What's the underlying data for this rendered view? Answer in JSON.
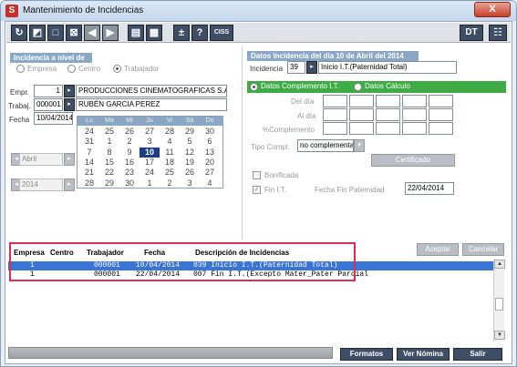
{
  "window": {
    "title": "Mantenimiento de Incidencias",
    "app_icon": "S",
    "close_glyph": "X"
  },
  "toolbar": {
    "buttons": [
      "↻",
      "◩",
      "□",
      "⊠",
      "◀",
      "▶",
      "▤",
      "▦",
      "±",
      "?",
      "CISS"
    ],
    "dt_label": "DT",
    "settings_glyph": "☷"
  },
  "left": {
    "section_title": "Incidencia a nivel de",
    "radio_empresa": "Empresa",
    "radio_centro": "Centro",
    "radio_trabajador": "Trabajador",
    "empr_label": "Empr.",
    "empr_value": "1",
    "empr_name": "PRODUCCIONES CINEMATOGRAFICAS S.A.",
    "trabaj_label": "Trabaj.",
    "trabaj_value": "000001",
    "trabaj_name": "RUBÉN GARCIA PEREZ",
    "fecha_label": "Fecha",
    "fecha_value": "10/04/2014",
    "month_value": "Abril",
    "year_value": "2014"
  },
  "calendar": {
    "days": [
      "Lu",
      "Ma",
      "Mi",
      "Ju",
      "Vi",
      "Sá",
      "Do"
    ],
    "weeks": [
      [
        "24",
        "25",
        "26",
        "27",
        "28",
        "29",
        "30"
      ],
      [
        "31",
        "1",
        "2",
        "3",
        "4",
        "5",
        "6"
      ],
      [
        "7",
        "8",
        "9",
        "10",
        "11",
        "12",
        "13"
      ],
      [
        "14",
        "15",
        "16",
        "17",
        "18",
        "19",
        "20"
      ],
      [
        "21",
        "22",
        "23",
        "24",
        "25",
        "26",
        "27"
      ],
      [
        "28",
        "29",
        "30",
        "1",
        "2",
        "3",
        "4"
      ]
    ],
    "selected_day": "10"
  },
  "right": {
    "section_title": "Datos Incidencia del día 10 de Abril del 2014",
    "incidencia_label": "Incidencia",
    "incidencia_code": "39",
    "incidencia_text": "Inicio I.T.(Paternidad Total)",
    "radio_complemento": "Datos Complemento I.T.",
    "radio_calculo": "Datos Cálculo",
    "del_dia_label": "Del día",
    "al_dia_label": "Al día",
    "complemento_label": "%Complemento",
    "tipo_compl_label": "Tipo Compl.",
    "tipo_compl_value": "no complementa",
    "certificado_btn": "Certificado",
    "bonificada_label": "Bonificada",
    "fin_it_label": "Fin I.T.",
    "fecha_fin_label": "Fecha Fin Paternidad",
    "fecha_fin_value": "22/04/2014",
    "aceptar_btn": "Aceptar",
    "cancelar_btn": "Cancelar"
  },
  "table": {
    "headers": [
      "Empresa",
      "Centro",
      "Trabajador",
      "Fecha",
      "Descripción de Incidencias"
    ],
    "rows": [
      {
        "empresa": "1",
        "centro": "",
        "trabajador": "000001",
        "fecha": "10/04/2014",
        "descripcion": "039 Inicio I.T.(Paternidad Total)"
      },
      {
        "empresa": "1",
        "centro": "",
        "trabajador": "000001",
        "fecha": "22/04/2014",
        "descripcion": "007 Fin I.T.(Excepto Mater_Pater Parcial"
      }
    ]
  },
  "footer": {
    "formatos_btn": "Formatos",
    "ver_nomina_btn": "Ver Nómina",
    "salir_btn": "Salir"
  },
  "colors": {
    "selection": "#3875d7",
    "section_header": "#8aa8c6",
    "green_bar": "#3eab45",
    "dark_button": "#3e4e66",
    "highlight_box": "#d9304f"
  }
}
